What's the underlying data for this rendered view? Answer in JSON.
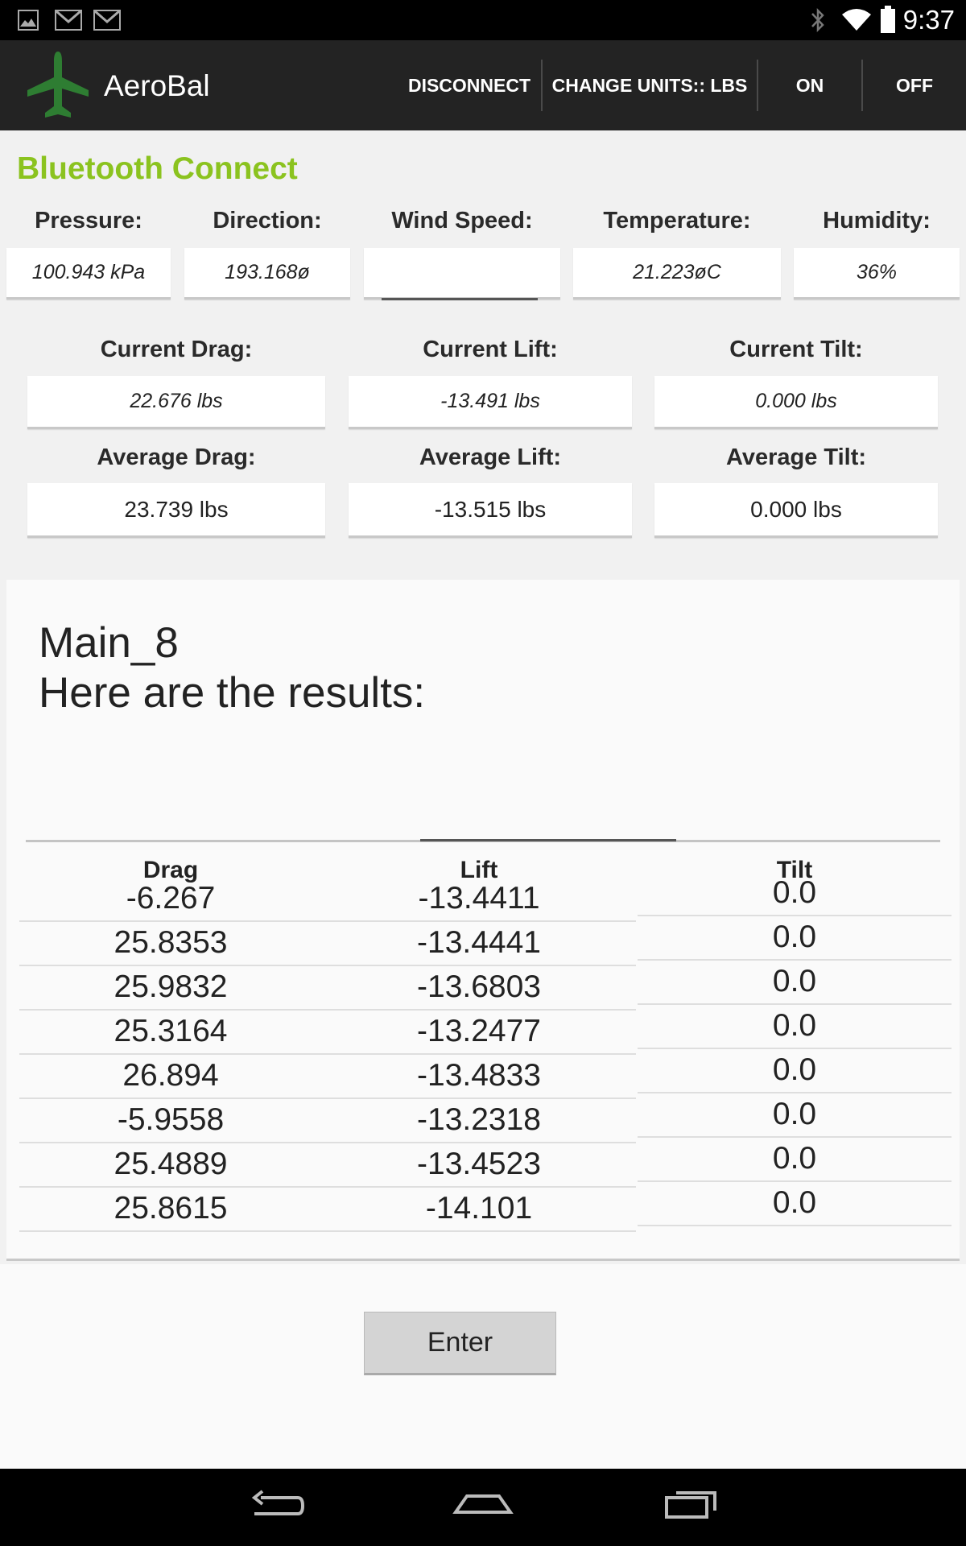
{
  "status_bar": {
    "time": "9:37",
    "left_icons": [
      "image-icon",
      "gmail-icon",
      "gmail-icon"
    ],
    "right_icons": [
      "bluetooth-icon",
      "wifi-icon",
      "battery-icon"
    ]
  },
  "action_bar": {
    "app_name": "AeroBal",
    "actions": {
      "disconnect": "DISCONNECT",
      "change_units": "CHANGE UNITS:: LBS",
      "on": "ON",
      "off": "OFF"
    }
  },
  "connection": {
    "title": "Bluetooth Connect"
  },
  "environment": {
    "pressure": {
      "label": "Pressure:",
      "value": "100.943 kPa"
    },
    "direction": {
      "label": "Direction:",
      "value": "193.168ø"
    },
    "wind_speed": {
      "label": "Wind Speed:",
      "value": ""
    },
    "temperature": {
      "label": "Temperature:",
      "value": "21.223øC"
    },
    "humidity": {
      "label": "Humidity:",
      "value": "36%"
    }
  },
  "current": {
    "drag": {
      "label": "Current Drag:",
      "value": "22.676 lbs"
    },
    "lift": {
      "label": "Current Lift:",
      "value": "-13.491 lbs"
    },
    "tilt": {
      "label": "Current Tilt:",
      "value": "0.000 lbs"
    }
  },
  "average": {
    "drag": {
      "label": "Average Drag:",
      "value": "23.739 lbs"
    },
    "lift": {
      "label": "Average Lift:",
      "value": "-13.515 lbs"
    },
    "tilt": {
      "label": "Average Tilt:",
      "value": "0.000 lbs"
    }
  },
  "results": {
    "heading_line1": "Main_8",
    "heading_line2": "Here are the results:",
    "columns": {
      "drag": "Drag",
      "lift": "Lift",
      "tilt": "Tilt"
    },
    "rows": [
      {
        "drag": "-6.267",
        "lift": "-13.4411",
        "tilt": "0.0"
      },
      {
        "drag": "25.8353",
        "lift": "-13.4441",
        "tilt": "0.0"
      },
      {
        "drag": "25.9832",
        "lift": "-13.6803",
        "tilt": "0.0"
      },
      {
        "drag": "25.3164",
        "lift": "-13.2477",
        "tilt": "0.0"
      },
      {
        "drag": "26.894",
        "lift": "-13.4833",
        "tilt": "0.0"
      },
      {
        "drag": "-5.9558",
        "lift": "-13.2318",
        "tilt": "0.0"
      },
      {
        "drag": "25.4889",
        "lift": "-13.4523",
        "tilt": "0.0"
      },
      {
        "drag": "25.8615",
        "lift": "-14.101",
        "tilt": "0.0"
      }
    ]
  },
  "enter_button": "Enter",
  "nav_bar": [
    "back-icon",
    "home-icon",
    "recents-icon"
  ],
  "colors": {
    "accent": "#8bc31f",
    "action_bar": "#232323",
    "status_bar": "#000000",
    "logo": "#2e7d32"
  }
}
